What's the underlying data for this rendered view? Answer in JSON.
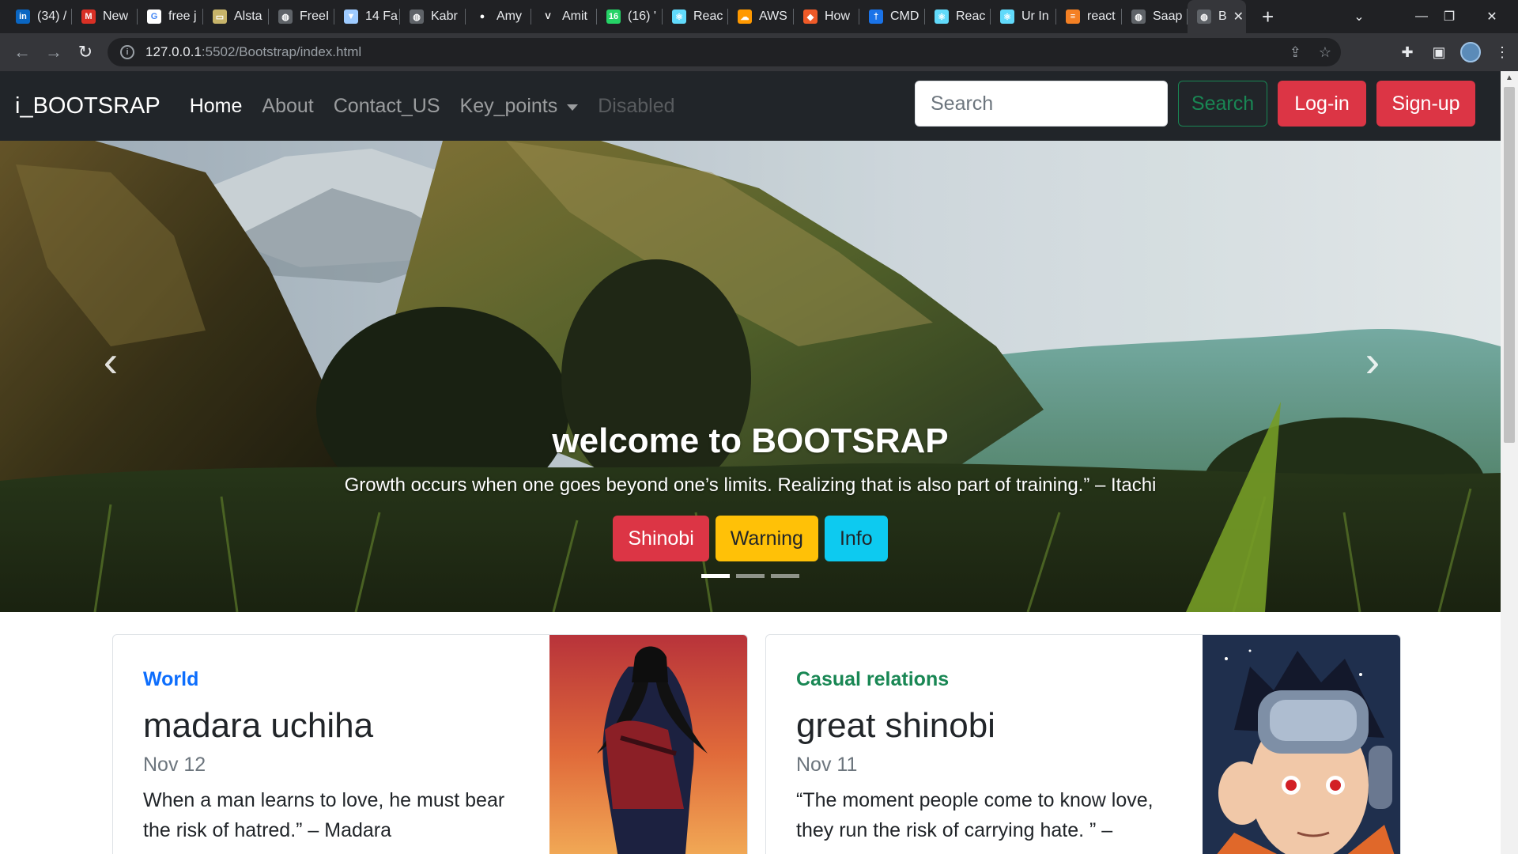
{
  "browser": {
    "tabs": [
      {
        "label": "(34) /",
        "icon": "linkedin-icon",
        "color": "#0a66c2",
        "glyph": "in"
      },
      {
        "label": "New",
        "icon": "fox-icon",
        "color": "#d93025",
        "glyph": "M"
      },
      {
        "label": "free j",
        "icon": "google-icon",
        "color": "#ffffff",
        "glyph": "G"
      },
      {
        "label": "Alsta",
        "icon": "card-icon",
        "color": "#c7b46a",
        "glyph": "▭"
      },
      {
        "label": "FreeI",
        "icon": "globe-icon",
        "color": "#5f6368",
        "glyph": "◍"
      },
      {
        "label": "14 Fa",
        "icon": "bookmark-icon",
        "color": "#9ecbff",
        "glyph": "▼"
      },
      {
        "label": "Kabr",
        "icon": "globe-icon",
        "color": "#5f6368",
        "glyph": "◍"
      },
      {
        "label": "Amy",
        "icon": "github-icon",
        "color": "#202124",
        "glyph": "●"
      },
      {
        "label": "Amit",
        "icon": "v-icon",
        "color": "#202124",
        "glyph": "V"
      },
      {
        "label": "(16) '",
        "icon": "whatsapp-icon",
        "color": "#25d366",
        "glyph": "16"
      },
      {
        "label": "Reac",
        "icon": "react-icon",
        "color": "#61dafb",
        "glyph": "⚛"
      },
      {
        "label": "AWS",
        "icon": "cloud-icon",
        "color": "#ff9900",
        "glyph": "☁"
      },
      {
        "label": "How",
        "icon": "diamond-icon",
        "color": "#ef5a28",
        "glyph": "◆"
      },
      {
        "label": "CMD",
        "icon": "pin-icon",
        "color": "#1a73e8",
        "glyph": "†"
      },
      {
        "label": "Reac",
        "icon": "react-icon",
        "color": "#61dafb",
        "glyph": "⚛"
      },
      {
        "label": "Ur In",
        "icon": "react-icon",
        "color": "#61dafb",
        "glyph": "⚛"
      },
      {
        "label": "react",
        "icon": "stack-icon",
        "color": "#f48024",
        "glyph": "≡"
      },
      {
        "label": "Saap",
        "icon": "globe-icon",
        "color": "#5f6368",
        "glyph": "◍"
      }
    ],
    "active_tab": {
      "label": "B",
      "icon": "globe-icon"
    },
    "new_tab_glyph": "+",
    "url_host": "127.0.0.1",
    "url_path": ":5502/Bootstrap/index.html"
  },
  "navbar": {
    "brand": "i_BOOTSRAP",
    "links": [
      {
        "label": "Home",
        "state": "active"
      },
      {
        "label": "About",
        "state": "normal"
      },
      {
        "label": "Contact_US",
        "state": "normal"
      },
      {
        "label": "Key_points",
        "state": "dropdown"
      },
      {
        "label": "Disabled",
        "state": "disabled"
      }
    ],
    "search_placeholder": "Search",
    "search_button": "Search",
    "login_button": "Log-in",
    "signup_button": "Sign-up"
  },
  "carousel": {
    "heading": "welcome to BOOTSRAP",
    "quote": "Growth occurs when one goes beyond one’s limits. Realizing that is also part of training.” – Itachi",
    "buttons": [
      {
        "label": "Shinobi",
        "variant": "danger"
      },
      {
        "label": "Warning",
        "variant": "warning"
      },
      {
        "label": "Info",
        "variant": "info"
      }
    ],
    "slides_count": 3,
    "active_slide": 0
  },
  "cards": [
    {
      "category": "World",
      "category_color": "#0d6efd",
      "title": "madara uchiha",
      "date": "Nov 12",
      "text": "When a man learns to love, he must bear the risk of hatred.” – Madara"
    },
    {
      "category": "Casual relations",
      "category_color": "#198754",
      "title": "great shinobi",
      "date": "Nov 11",
      "text": "“The moment people come to know love, they run the risk of carrying hate. ” –"
    }
  ],
  "colors": {
    "navbar_bg": "#212529",
    "danger": "#dc3545",
    "warning": "#ffc107",
    "info": "#0dcaf0",
    "success": "#198754",
    "primary": "#0d6efd"
  }
}
